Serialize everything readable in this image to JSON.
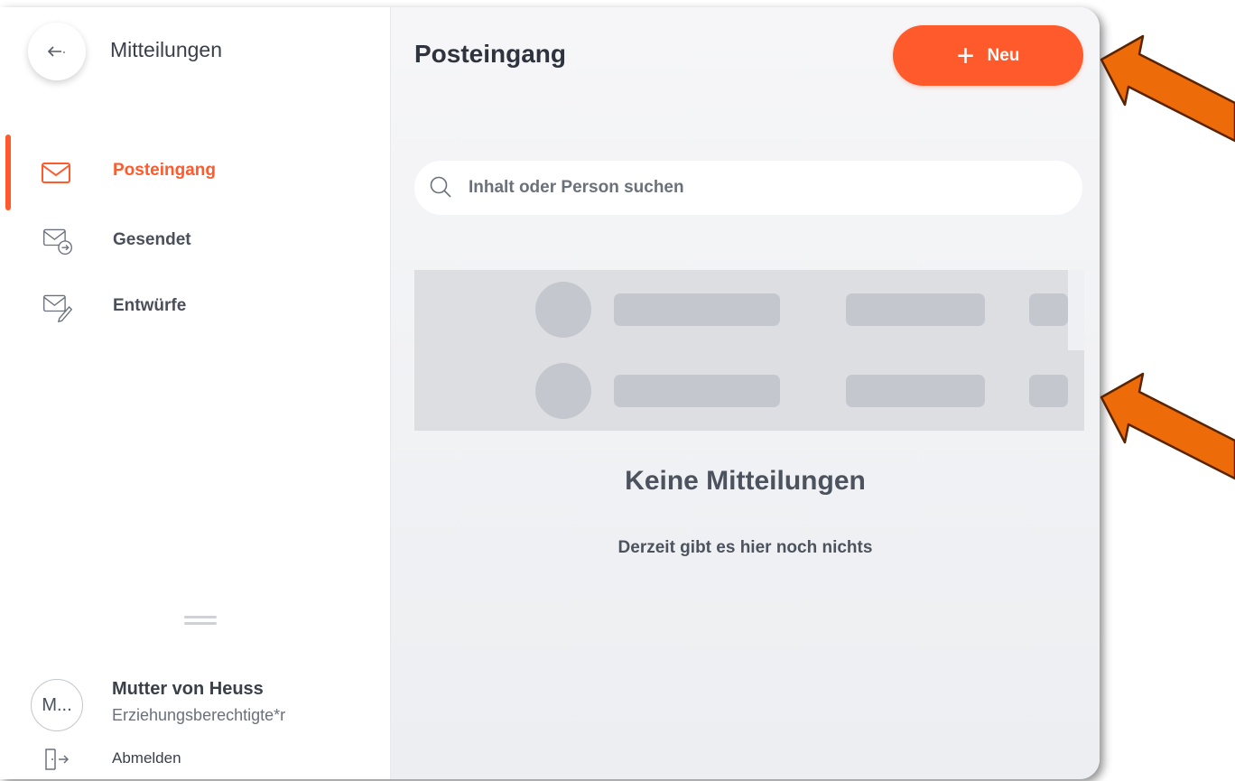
{
  "sidebar": {
    "title": "Mitteilungen",
    "items": [
      {
        "label": "Posteingang",
        "icon": "envelope-icon",
        "active": true
      },
      {
        "label": "Gesendet",
        "icon": "envelope-sent-icon",
        "active": false
      },
      {
        "label": "Entwürfe",
        "icon": "envelope-draft-icon",
        "active": false
      }
    ],
    "user": {
      "avatar_text": "M...",
      "name": "Mutter von Heuss",
      "role": "Erziehungsberechtigte*r"
    },
    "logout_label": "Abmelden"
  },
  "main": {
    "title": "Posteingang",
    "new_button": {
      "plus": "+",
      "label": "Neu"
    },
    "search": {
      "placeholder": "Inhalt oder Person suchen",
      "value": ""
    },
    "empty_state": {
      "title": "Keine Mitteilungen",
      "subtitle": "Derzeit gibt es hier noch nichts"
    }
  },
  "colors": {
    "accent": "#ff5a2c",
    "annotation_arrow": "#ee6b0a"
  }
}
